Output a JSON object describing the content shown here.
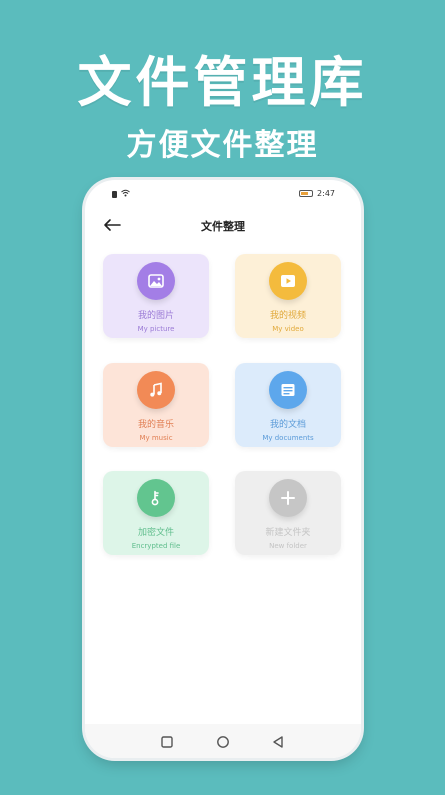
{
  "headline": "文件管理库",
  "subheadline": "方便文件整理",
  "status_bar": {
    "time": "2:47"
  },
  "app_bar": {
    "title": "文件整理",
    "back_icon": "arrow-left-icon"
  },
  "cards": [
    {
      "title": "我的图片",
      "subtitle": "My picture",
      "icon": "image-icon",
      "bg": "#ece4fb",
      "circle": "#a37ee6",
      "text_color": "#9b7bd6"
    },
    {
      "title": "我的视频",
      "subtitle": "My video",
      "icon": "play-icon",
      "bg": "#fdf0d7",
      "circle": "#f4bb3d",
      "text_color": "#e1a93a"
    },
    {
      "title": "我的音乐",
      "subtitle": "My music",
      "icon": "music-note-icon",
      "bg": "#fde4d8",
      "circle": "#f28a56",
      "text_color": "#e17f54"
    },
    {
      "title": "我的文档",
      "subtitle": "My documents",
      "icon": "document-icon",
      "bg": "#dcebfb",
      "circle": "#5da7ec",
      "text_color": "#5b9bd8"
    },
    {
      "title": "加密文件",
      "subtitle": "Encrypted file",
      "icon": "key-icon",
      "bg": "#ddf5e8",
      "circle": "#62c58f",
      "text_color": "#5fbd8c"
    },
    {
      "title": "新建文件夹",
      "subtitle": "New folder",
      "icon": "plus-icon",
      "bg": "#eeeeee",
      "circle": "#c6c6c6",
      "text_color": "#c4c4c4"
    }
  ],
  "nav_bar": {
    "recents_icon": "square-icon",
    "home_icon": "circle-icon",
    "back_icon": "triangle-back-icon"
  }
}
